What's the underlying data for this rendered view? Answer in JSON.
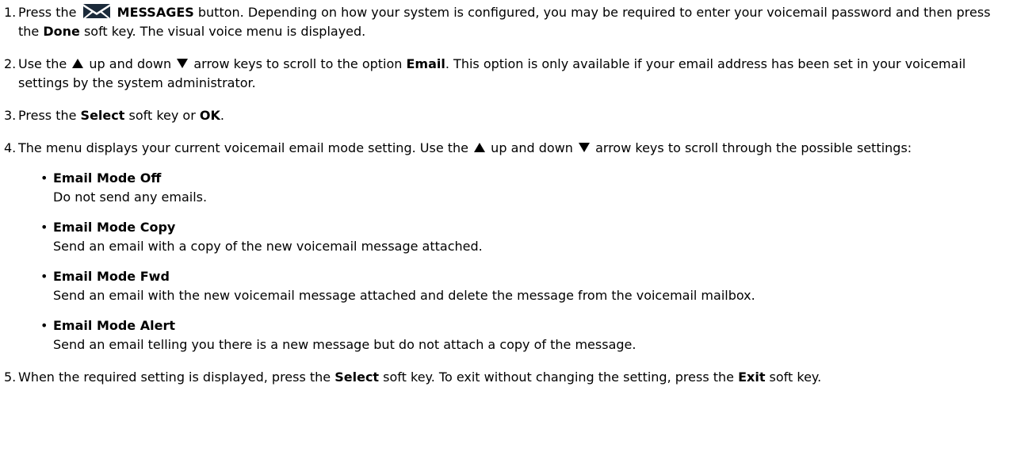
{
  "steps": [
    {
      "num": "1.",
      "parts": {
        "a": "Press the",
        "b": "MESSAGES",
        "c": " button. Depending on how your system is configured, you may be required to enter your voicemail password and then press the ",
        "d": "Done",
        "e": " soft key. The visual voice menu is displayed."
      }
    },
    {
      "num": "2.",
      "parts": {
        "a": "Use the ",
        "b": " up and down ",
        "c": " arrow keys to scroll to the option ",
        "d": "Email",
        "e": ". This option is only available if your email address has been set in your voicemail settings by the system administrator."
      }
    },
    {
      "num": "3.",
      "parts": {
        "a": "Press the ",
        "b": "Select",
        "c": " soft key or ",
        "d": "OK",
        "e": "."
      }
    },
    {
      "num": "4.",
      "parts": {
        "a": "The menu displays your current voicemail email mode setting. Use the ",
        "b": " up and down ",
        "c": " arrow keys to scroll through the possible settings:"
      },
      "modes": [
        {
          "title": "Email Mode Off",
          "desc": "Do not send any emails."
        },
        {
          "title": "Email Mode Copy",
          "desc": "Send an email with a copy of the new voicemail message attached."
        },
        {
          "title": "Email Mode Fwd",
          "desc": "Send an email with the new voicemail message attached and delete the message from the voicemail mailbox."
        },
        {
          "title": "Email Mode Alert",
          "desc": "Send an email telling you there is a new message but do not attach a copy of the message."
        }
      ]
    },
    {
      "num": "5.",
      "parts": {
        "a": "When the required setting is displayed, press the ",
        "b": "Select",
        "c": " soft key. To exit without changing the setting, press the ",
        "d": "Exit",
        "e": " soft key."
      }
    }
  ],
  "bullet_char": "•",
  "icons": {
    "messages": "envelope-messages-icon",
    "up": "up-arrow-icon",
    "down": "down-arrow-icon"
  }
}
